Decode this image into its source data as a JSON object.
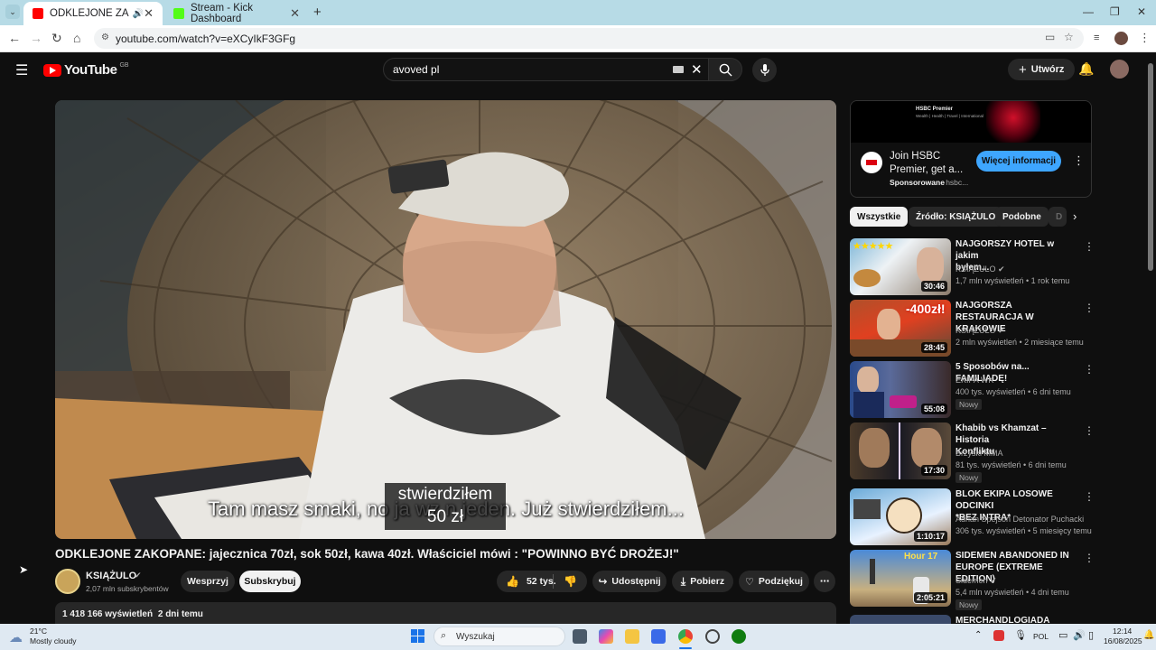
{
  "browser": {
    "tabs": [
      {
        "title": "ODKLEJONE ZAKOPANE: ja",
        "audio_icon": "speaker-icon"
      },
      {
        "title": "Stream - Kick Dashboard"
      }
    ],
    "url": "youtube.com/watch?v=eXCyIkF3GFg"
  },
  "youtube": {
    "logo": "YouTube",
    "region": "GB",
    "search_value": "avoved pl",
    "create_label": "Utwórz"
  },
  "video": {
    "caption_main": "Tam masz smaki, no ja wz n jeden. Już stwierdziłem...",
    "caption_box_line1": "stwierdziłem",
    "caption_box_line2": "50 zł",
    "title": "ODKLEJONE ZAKOPANE: jajecznica 70zł, sok 50zł, kawa 40zł. Właściciel mówi : \"POWINNO BYĆ DROŻEJ!\"",
    "channel": "KSIĄŻULO",
    "subscribers": "2,07 mln subskrybentów",
    "support_label": "Wesprzyj",
    "subscribe_label": "Subskrybuj",
    "likes": "52 tys.",
    "share_label": "Udostępnij",
    "download_label": "Pobierz",
    "thanks_label": "Podziękuj",
    "views": "1 418 166 wyświetleń",
    "age": "2 dni temu"
  },
  "ad": {
    "banner_brand": "HSBC Premier",
    "banner_tag": "Wealth | Health | Travel | International",
    "title_line1": "Join HSBC",
    "title_line2": "Premier, get a...",
    "sponsored": "Sponsorowane",
    "advertiser": "· hsbc...",
    "cta": "Więcej informacji"
  },
  "chips": [
    "Wszystkie",
    "Źródło: KSIĄŻULO",
    "Podobne",
    "D"
  ],
  "recommendations": [
    {
      "title_l1": "NAJGORSZY HOTEL w jakim",
      "title_l2": "byłem...",
      "channel": "KSIĄŻULO",
      "meta": "1,7 mln wyświetleń • 1 rok temu",
      "duration": "30:46",
      "badge": ""
    },
    {
      "title_l1": "NAJGORSZA RESTAURACJA W",
      "title_l2": "KRAKOWIE",
      "channel": "KSIĄŻULO",
      "meta": "2 mln wyświetleń • 2 miesiące temu",
      "duration": "28:45",
      "badge": ""
    },
    {
      "title_l1": "5 Sposobów na... FAMILIADĘ!",
      "title_l2": "",
      "channel": "EKIPA WK",
      "meta": "400 tys. wyświetleń • 6 dni temu",
      "duration": "55:08",
      "badge": "Nowy"
    },
    {
      "title_l1": "Khabib vs Khamzat – Historia",
      "title_l2": "Konfliktu",
      "channel": "Brzyski MMA",
      "meta": "81 tys. wyświetleń • 6 dni temu",
      "duration": "17:30",
      "badge": "Nowy"
    },
    {
      "title_l1": "BLOK EKIPA LOSOWE ODCINKI",
      "title_l2": "*BEZ INTRA*",
      "channel": "Adrian Spejson Detonator Puchacki",
      "meta": "306 tys. wyświetleń • 5 miesięcy temu",
      "duration": "1:10:17",
      "badge": ""
    },
    {
      "title_l1": "SIDEMEN ABANDONED IN",
      "title_l2": "EUROPE (EXTREME EDITION)",
      "channel": "Sidemen",
      "meta": "5,4 mln wyświetleń • 4 dni temu",
      "duration": "2:05:21",
      "badge": "Nowy"
    },
    {
      "title_l1": "MERCHANDLOGIADA",
      "title_l2": "",
      "channel": "",
      "meta": "",
      "duration": "",
      "badge": ""
    }
  ],
  "taskbar": {
    "weather_temp": "21°C",
    "weather_desc": "Mostly cloudy",
    "search_placeholder": "Wyszukaj",
    "lang": "POL",
    "time": "12:14",
    "date": "16/08/2025"
  },
  "colors": {
    "yt_red": "#ff0000",
    "accent_blue": "#3ea6ff",
    "subscribe_bg": "#f1f1f1"
  }
}
